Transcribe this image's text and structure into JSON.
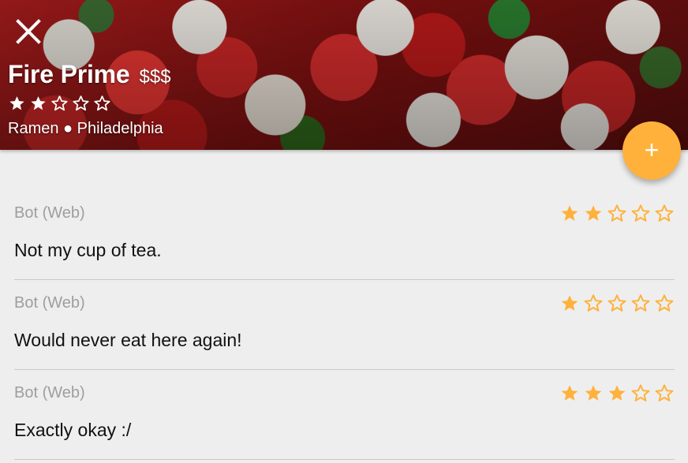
{
  "header": {
    "title": "Fire Prime",
    "price": "$$$",
    "rating": 2,
    "max_rating": 5,
    "subtitle": "Ramen ● Philadelphia",
    "close_icon": "close-icon",
    "add_button_label": "+",
    "accent_color": "#FFB13B"
  },
  "reviews": [
    {
      "author": "Bot (Web)",
      "rating": 2,
      "text": "Not my cup of tea."
    },
    {
      "author": "Bot (Web)",
      "rating": 1,
      "text": "Would never eat here again!"
    },
    {
      "author": "Bot (Web)",
      "rating": 3,
      "text": "Exactly okay :/"
    }
  ]
}
